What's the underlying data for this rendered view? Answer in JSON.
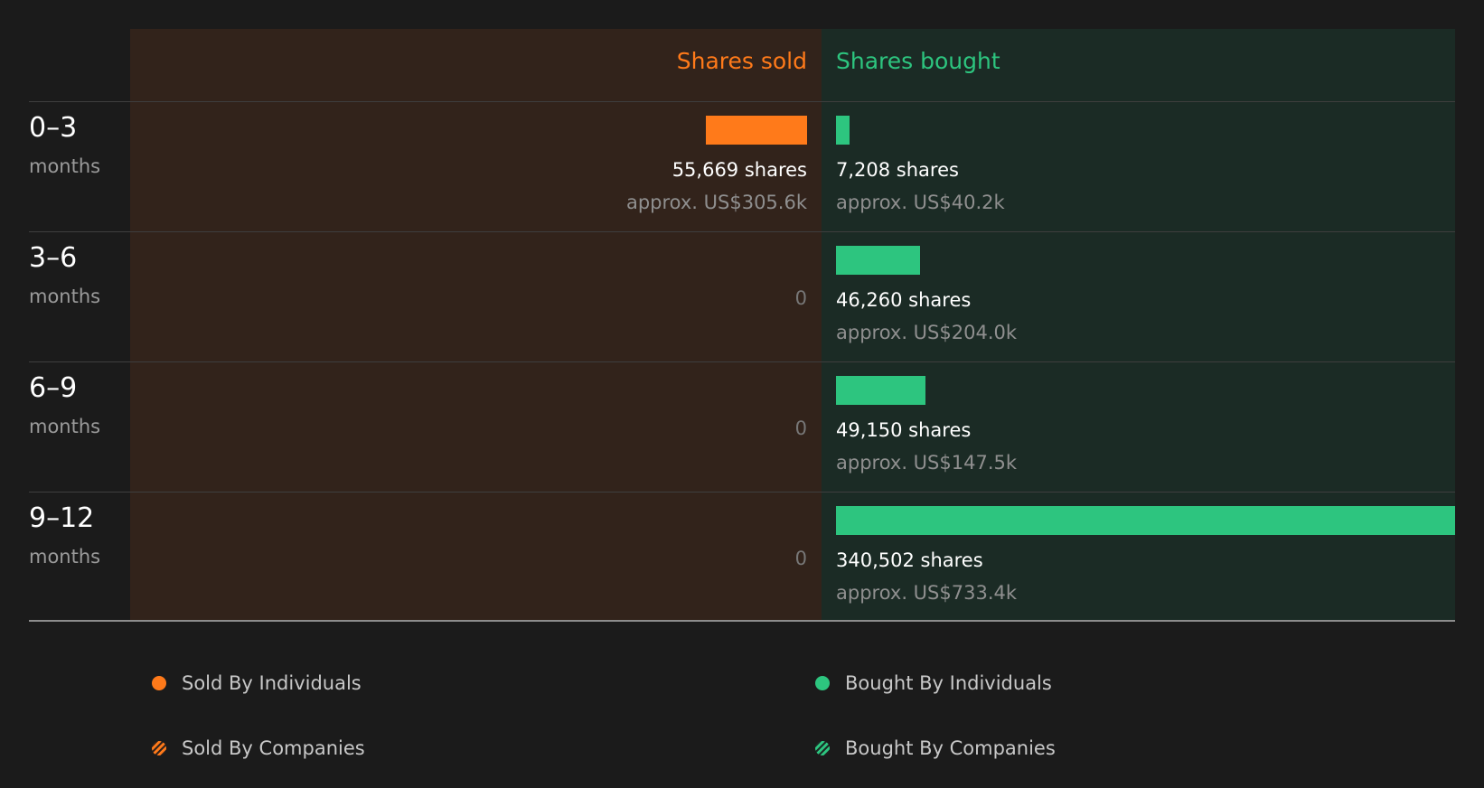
{
  "chart_data": {
    "type": "bar",
    "headers": {
      "sold": "Shares sold",
      "bought": "Shares bought"
    },
    "max_shares": 340502,
    "zero_label": "0",
    "rows": [
      {
        "range": "0–3",
        "unit": "months",
        "sold": 55669,
        "sold_shares_text": "55,669 shares",
        "sold_value_text": "approx. US$305.6k",
        "bought": 7208,
        "bought_shares_text": "7,208 shares",
        "bought_value_text": "approx. US$40.2k"
      },
      {
        "range": "3–6",
        "unit": "months",
        "sold": 0,
        "sold_shares_text": "",
        "sold_value_text": "",
        "bought": 46260,
        "bought_shares_text": "46,260 shares",
        "bought_value_text": "approx. US$204.0k"
      },
      {
        "range": "6–9",
        "unit": "months",
        "sold": 0,
        "sold_shares_text": "",
        "sold_value_text": "",
        "bought": 49150,
        "bought_shares_text": "49,150 shares",
        "bought_value_text": "approx. US$147.5k"
      },
      {
        "range": "9–12",
        "unit": "months",
        "sold": 0,
        "sold_shares_text": "",
        "sold_value_text": "",
        "bought": 340502,
        "bought_shares_text": "340,502 shares",
        "bought_value_text": "approx. US$733.4k"
      }
    ],
    "legend": [
      {
        "label": "Sold By Individuals",
        "style": "solid",
        "color": "#ff7a1a"
      },
      {
        "label": "Bought By Individuals",
        "style": "solid",
        "color": "#2dc57f"
      },
      {
        "label": "Sold By Companies",
        "style": "hatched",
        "color": "#ff7a1a"
      },
      {
        "label": "Bought By Companies",
        "style": "hatched",
        "color": "#2dc57f"
      }
    ],
    "colors": {
      "sold": "#ff7a1a",
      "bought": "#2dc57f"
    }
  }
}
